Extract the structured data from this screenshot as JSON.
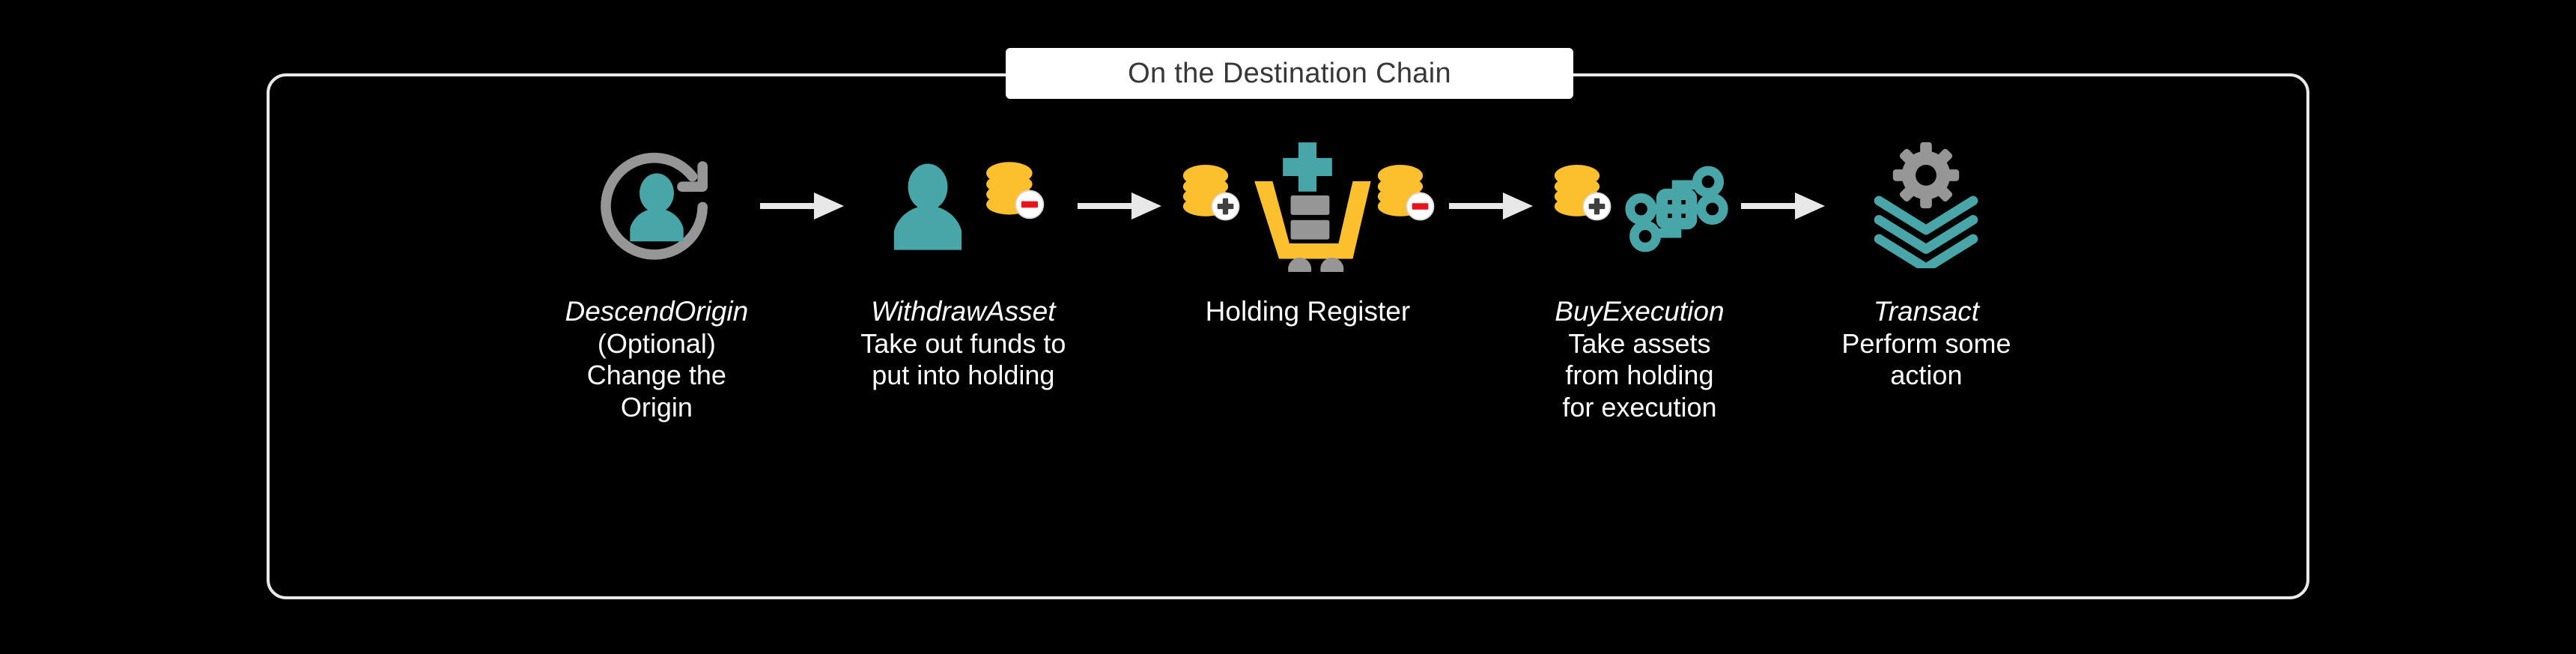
{
  "banner": {
    "title": "On the Destination Chain"
  },
  "theme": {
    "background": "#000000",
    "frame_border": "#e9e9e9",
    "banner_background": "#ffffff",
    "banner_text": "#373737",
    "label_text": "#ffffff",
    "teal": "#48a6a9",
    "yellow": "#fcbf2e",
    "gray": "#969696",
    "arrow": "#e8e8e8",
    "badge_plus": "#3f3f3f",
    "badge_minus": "#e8141b",
    "badge_circle": "#ffffff"
  },
  "stages": [
    {
      "id": "descend-origin",
      "name": "DescendOrigin",
      "name_style": "italic",
      "desc_lines": [
        "(Optional)",
        "Change the",
        "Origin"
      ],
      "icons": [
        "person-rotate-icon"
      ]
    },
    {
      "id": "withdraw-asset",
      "name": "WithdrawAsset",
      "name_style": "italic",
      "desc_lines": [
        "Take out funds to",
        "put into holding"
      ],
      "icons": [
        "person-icon",
        "coin-stack-minus-icon"
      ]
    },
    {
      "id": "holding-register",
      "name": "Holding Register",
      "name_style": "normal",
      "desc_lines": [],
      "icons": [
        "coin-stack-plus-icon",
        "shopping-cart-icon",
        "coin-stack-minus-icon"
      ]
    },
    {
      "id": "buy-execution",
      "name": "BuyExecution",
      "name_style": "italic",
      "desc_lines": [
        "Take assets",
        "from holding",
        "for execution"
      ],
      "icons": [
        "coin-stack-plus-icon",
        "network-nodes-icon"
      ]
    },
    {
      "id": "transact",
      "name": "Transact",
      "name_style": "italic",
      "desc_lines": [
        "Perform some",
        "action"
      ],
      "icons": [
        "gear-layers-icon"
      ]
    }
  ],
  "arrows": [
    {
      "id": "arrow-1",
      "from": "descend-origin",
      "to": "withdraw-asset"
    },
    {
      "id": "arrow-2",
      "from": "withdraw-asset",
      "to": "holding-register"
    },
    {
      "id": "arrow-3",
      "from": "holding-register",
      "to": "buy-execution"
    },
    {
      "id": "arrow-4",
      "from": "buy-execution",
      "to": "transact"
    }
  ]
}
